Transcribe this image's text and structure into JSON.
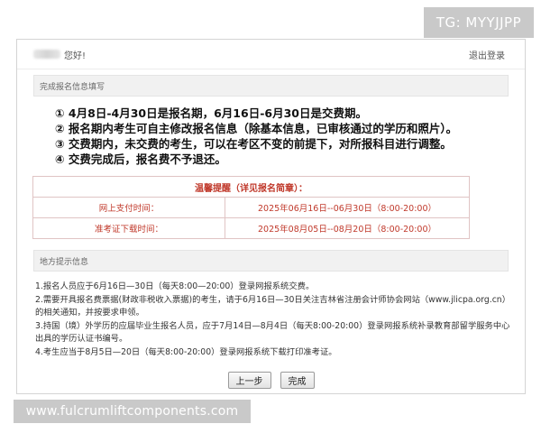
{
  "watermarks": {
    "top_right": "TG: MYYJJPP",
    "bottom_left": "www.fulcrumliftcomponents.com"
  },
  "header": {
    "greeting": "您好!",
    "logout": "退出登录"
  },
  "section1": {
    "title": "完成报名信息填写",
    "notices": [
      "① 4月8日-4月30日是报名期，6月16日-6月30日是交费期。",
      "② 报名期内考生可自主修改报名信息（除基本信息，已审核通过的学历和照片）。",
      "③ 交费期内，未交费的考生，可以在考区不变的前提下，对所报科目进行调整。",
      "④ 交费完成后，报名费不予退还。"
    ],
    "table": {
      "caption": "温馨提醒（详见报名简章）：",
      "rows": [
        {
          "label": "网上支付时间：",
          "value": "2025年06月16日--06月30日（8:00-20:00）"
        },
        {
          "label": "准考证下载时间：",
          "value": "2025年08月05日--08月20日（8:00-20:00）"
        }
      ]
    }
  },
  "section2": {
    "title": "地方提示信息",
    "tips": [
      "1.报名人员应于6月16日—30日（每天8:00—20:00）登录网报系统交费。",
      "2.需要开具报名费票据(财政非税收入票据)的考生，请于6月16日—30日关注吉林省注册会计师协会网站（www.jlicpa.org.cn）的相关通知，并按要求申领。",
      "3.持国（境）外学历的应届毕业生报名人员，应于7月14日—8月4日（每天8:00-20:00）登录网报系统补录教育部留学服务中心出具的学历认证书编号。",
      "4.考生应当于8月5日—20日（每天8:00-20:00）登录网报系统下载打印准考证。"
    ]
  },
  "buttons": {
    "prev": "上一步",
    "finish": "完成"
  }
}
